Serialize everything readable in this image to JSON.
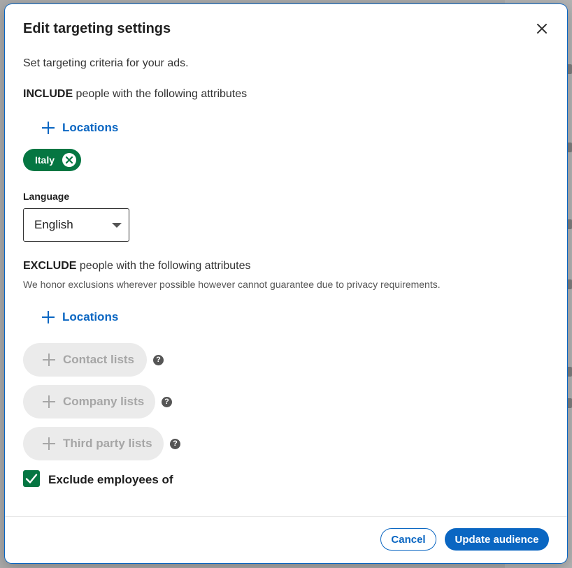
{
  "modal": {
    "title": "Edit targeting settings",
    "subtitle": "Set targeting criteria for your ads."
  },
  "include": {
    "keyword": "INCLUDE",
    "rest": " people with the following attributes",
    "add_locations_label": "Locations",
    "selected_locations": [
      "Italy"
    ]
  },
  "language": {
    "label": "Language",
    "selected": "English"
  },
  "exclude": {
    "keyword": "EXCLUDE",
    "rest": " people with the following attributes",
    "note": "We honor exclusions wherever possible however cannot guarantee due to privacy requirements.",
    "add_locations_label": "Locations",
    "list_buttons": [
      "Contact lists",
      "Company lists",
      "Third party lists"
    ],
    "help_glyph": "?",
    "exclude_employees_label": "Exclude employees of",
    "exclude_employees_checked": true
  },
  "footer": {
    "cancel_label": "Cancel",
    "update_label": "Update audience"
  },
  "colors": {
    "brand_blue": "#0a66c2",
    "chip_green": "#057642",
    "disabled_bg": "#ebebeb",
    "disabled_text": "#a6a6a6"
  },
  "icons": {
    "close": "close-icon",
    "add": "plus-icon",
    "remove_chip": "circle-x-icon",
    "help": "question-circle-icon",
    "dropdown": "caret-down-icon",
    "checkbox": "checkmark-icon"
  }
}
